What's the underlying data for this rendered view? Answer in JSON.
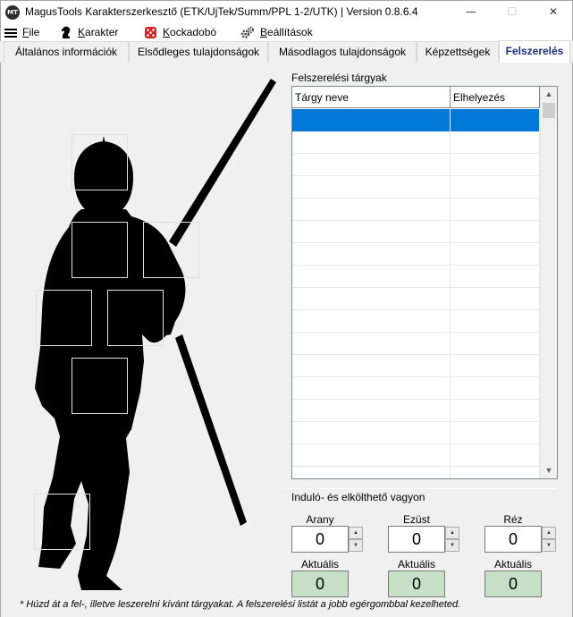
{
  "window": {
    "logo_text": "MT",
    "title": "MagusTools Karakterszerkesztő (ETK/UjTek/Summ/PPL 1-2/UTK) | Version 0.8.6.4",
    "minimize": "—",
    "maximize": "☐",
    "close": "✕"
  },
  "menu": {
    "file": {
      "prefix": "",
      "underline": "F",
      "rest": "ile"
    },
    "karakter": {
      "prefix": "",
      "underline": "K",
      "rest": "arakter"
    },
    "kockadobo": {
      "prefix": "",
      "underline": "K",
      "rest": "ockadobó"
    },
    "beallitasok": {
      "prefix": "",
      "underline": "B",
      "rest": "eállítások"
    }
  },
  "tabs": [
    {
      "label": "Általános információk"
    },
    {
      "label": "Elsődleges tulajdonságok"
    },
    {
      "label": "Másodlagos tulajdonságok"
    },
    {
      "label": "Képzettségek"
    },
    {
      "label": "Felszerelés"
    }
  ],
  "equipment": {
    "section_label": "Felszerelési tárgyak",
    "columns": [
      "Tárgy neve",
      "Elhelyezés"
    ],
    "rows": [
      "",
      "",
      "",
      "",
      "",
      "",
      "",
      "",
      "",
      "",
      "",
      "",
      "",
      "",
      "",
      "",
      ""
    ],
    "selected_row": 0,
    "scroll_up": "▲",
    "scroll_down": "▼"
  },
  "wealth": {
    "section_label": "Induló- és elkölthető vagyon",
    "coins": [
      {
        "label": "Arany",
        "value": "0",
        "actual_label": "Aktuális",
        "actual_value": "0"
      },
      {
        "label": "Ezüst",
        "value": "0",
        "actual_label": "Aktuális",
        "actual_value": "0"
      },
      {
        "label": "Réz",
        "value": "0",
        "actual_label": "Aktuális",
        "actual_value": "0"
      }
    ],
    "spin_up": "▲",
    "spin_down": "▼"
  },
  "hint": "* Húzd át a fel-, illetve leszerelni kívánt tárgyakat. A felszerelési listát a jobb egérgombbal kezelheted.",
  "colors": {
    "selection": "#0078d7",
    "actual_bg": "#c6e0c6",
    "active_tab_text": "#1c2b7a"
  }
}
